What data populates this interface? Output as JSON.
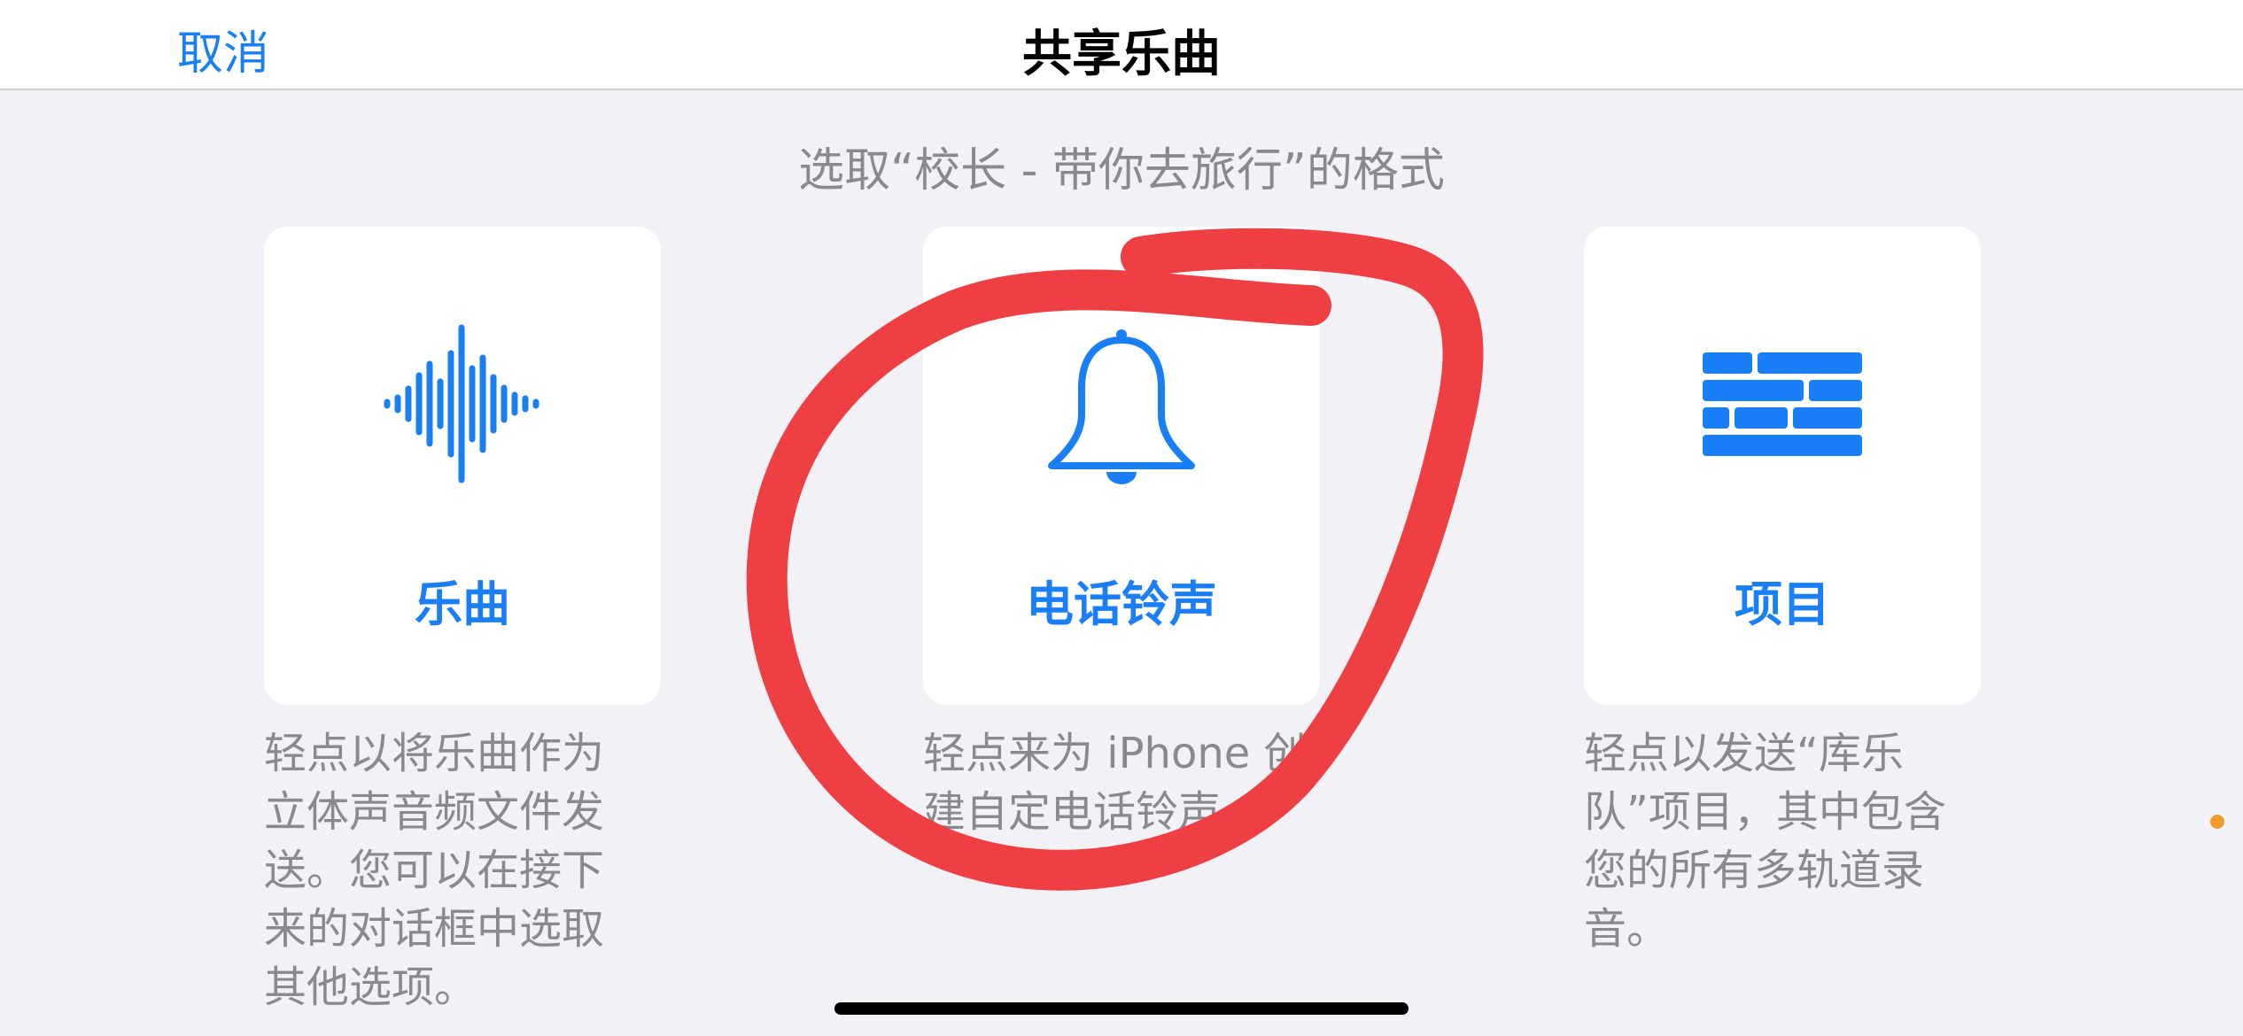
{
  "nav": {
    "cancel": "取消",
    "title": "共享乐曲"
  },
  "subtitle": "选取“校长 - 带你去旅行”的格式",
  "cards": [
    {
      "icon": "waveform-icon",
      "label": "乐曲",
      "description_lines": [
        "轻点以将乐曲作为",
        "立体声音频文件发",
        "送。您可以在接下",
        "来的对话框中选取",
        "其他选项。"
      ]
    },
    {
      "icon": "bell-icon",
      "label": "电话铃声",
      "description_lines": [
        "轻点来为 iPhone 创",
        "建自定电话铃声。"
      ]
    },
    {
      "icon": "brick-wall-icon",
      "label": "项目",
      "description_lines": [
        "轻点以发送“库乐",
        "队”项目，其中包含",
        "您的所有多轨道录",
        "音。"
      ]
    }
  ],
  "colors": {
    "accent": "#1a7ff6",
    "background": "#f2f1f6",
    "secondary_text": "#8a8a8e",
    "annotation_red": "#ee3f43",
    "status_dot": "#f39a2c"
  }
}
